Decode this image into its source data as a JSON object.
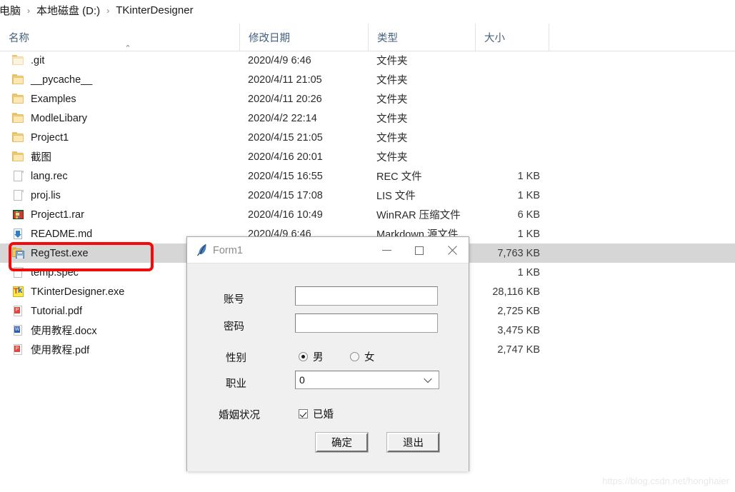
{
  "breadcrumb": {
    "items": [
      "电脑",
      "本地磁盘 (D:)",
      "TKinterDesigner"
    ],
    "separator": "›"
  },
  "columns": {
    "name": "名称",
    "date": "修改日期",
    "type": "类型",
    "size": "大小",
    "sort_caret": "⌃"
  },
  "files": [
    {
      "icon": "folder-dim-icon",
      "name": ".git",
      "date": "2020/4/9 6:46",
      "type": "文件夹",
      "size": "",
      "selected": false
    },
    {
      "icon": "folder-icon",
      "name": "__pycache__",
      "date": "2020/4/11 21:05",
      "type": "文件夹",
      "size": "",
      "selected": false
    },
    {
      "icon": "folder-icon",
      "name": "Examples",
      "date": "2020/4/11 20:26",
      "type": "文件夹",
      "size": "",
      "selected": false
    },
    {
      "icon": "folder-icon",
      "name": "ModleLibary",
      "date": "2020/4/2 22:14",
      "type": "文件夹",
      "size": "",
      "selected": false
    },
    {
      "icon": "folder-icon",
      "name": "Project1",
      "date": "2020/4/15 21:05",
      "type": "文件夹",
      "size": "",
      "selected": false
    },
    {
      "icon": "folder-icon",
      "name": "截图",
      "date": "2020/4/16 20:01",
      "type": "文件夹",
      "size": "",
      "selected": false
    },
    {
      "icon": "document-icon",
      "name": "lang.rec",
      "date": "2020/4/15 16:55",
      "type": "REC 文件",
      "size": "1 KB",
      "selected": false
    },
    {
      "icon": "document-icon",
      "name": "proj.lis",
      "date": "2020/4/15 17:08",
      "type": "LIS 文件",
      "size": "1 KB",
      "selected": false
    },
    {
      "icon": "winrar-icon",
      "name": "Project1.rar",
      "date": "2020/4/16 10:49",
      "type": "WinRAR 压缩文件",
      "size": "6 KB",
      "selected": false
    },
    {
      "icon": "markdown-icon",
      "name": "README.md",
      "date": "2020/4/9 6:46",
      "type": "Markdown 源文件",
      "size": "1 KB",
      "selected": false
    },
    {
      "icon": "exe-app-icon",
      "name": "RegTest.exe",
      "date": "",
      "type": "",
      "size": "7,763 KB",
      "selected": true
    },
    {
      "icon": "document-icon",
      "name": "temp.spec",
      "date": "",
      "type": "",
      "size": "1 KB",
      "selected": false
    },
    {
      "icon": "tk-app-icon",
      "name": "TKinterDesigner.exe",
      "date": "",
      "type": "",
      "size": "28,116 KB",
      "selected": false
    },
    {
      "icon": "pdf-icon",
      "name": "Tutorial.pdf",
      "date": "",
      "type": "",
      "size": "2,725 KB",
      "selected": false
    },
    {
      "icon": "docx-icon",
      "name": "使用教程.docx",
      "date": "",
      "type": "",
      "size": "3,475 KB",
      "selected": false
    },
    {
      "icon": "pdf-icon",
      "name": "使用教程.pdf",
      "date": "",
      "type": "",
      "size": "2,747 KB",
      "selected": false
    }
  ],
  "annotation": {
    "target": "RegTest.exe",
    "color": "#f00c0c"
  },
  "dialog": {
    "title": "Form1",
    "icon": "tkinter-feather-icon",
    "window_buttons": {
      "minimize": "–",
      "maximize": "□",
      "close": "✕"
    },
    "fields": {
      "account_label": "账号",
      "account_value": "",
      "password_label": "密码",
      "password_value": "",
      "gender_label": "性别",
      "gender_male": "男",
      "gender_female": "女",
      "gender_selected": "男",
      "occupation_label": "职业",
      "occupation_value": "0",
      "marital_label": "婚姻状况",
      "marital_option": "已婚",
      "marital_checked": true
    },
    "buttons": {
      "ok": "确定",
      "exit": "退出"
    }
  },
  "watermark": "https://blog.csdn.net/honghaier"
}
